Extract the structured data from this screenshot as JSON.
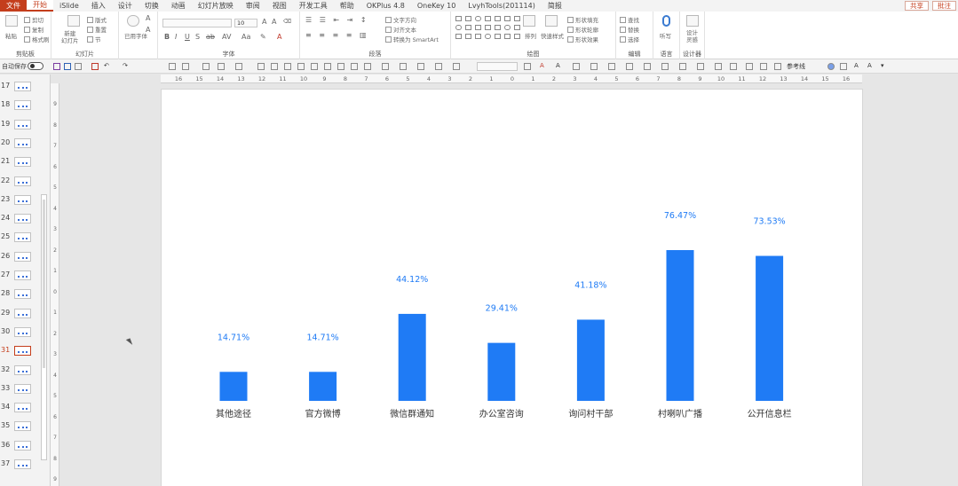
{
  "colors": {
    "accent": "#c43e1c",
    "bar": "#1f7bf5",
    "label": "#1f7bf5",
    "category": "#333333"
  },
  "menu": {
    "tabs": [
      "文件",
      "开始",
      "iSlide",
      "插入",
      "设计",
      "切换",
      "动画",
      "幻灯片放映",
      "审阅",
      "视图",
      "开发工具",
      "帮助",
      "OKPlus 4.8",
      "OneKey 10",
      "LvyhTools(201114)",
      "简报"
    ],
    "active": "开始",
    "share": "共享",
    "comment": "批注"
  },
  "ribbon": {
    "groups": {
      "clipboard": {
        "label": "剪贴板",
        "paste": "粘贴",
        "cut": "剪切",
        "copy": "复制",
        "format_painter": "格式刷"
      },
      "slides": {
        "label": "幻灯片",
        "new_slide": "新建\n幻灯片",
        "layout": "版式",
        "reset": "重置",
        "section": "节"
      },
      "fonts": {
        "label": "字体",
        "used_fonts": "已用字体",
        "font_size": "10"
      },
      "paragraph": {
        "label": "段落",
        "text_direction": "文字方向",
        "align_text": "对齐文本",
        "smartart": "转换为 SmartArt"
      },
      "drawing": {
        "label": "绘图",
        "arrange": "排列",
        "quick_styles": "快速样式",
        "shape_fill": "形状填充",
        "shape_outline": "形状轮廓",
        "shape_effects": "形状效果"
      },
      "editing": {
        "label": "编辑",
        "find": "查找",
        "replace": "替换",
        "select": "选择"
      },
      "voice": {
        "label": "语言",
        "dictate": "听写"
      },
      "designer": {
        "label": "设计器",
        "design_ideas": "设计\n灵感"
      }
    }
  },
  "qat": {
    "autosave": "自动保存",
    "autosave_state": "关",
    "reference_line": "参考线"
  },
  "thumbnails": {
    "numbers": [
      "17",
      "18",
      "19",
      "20",
      "21",
      "22",
      "23",
      "24",
      "25",
      "26",
      "27",
      "28",
      "29",
      "30",
      "31",
      "32",
      "33",
      "34",
      "35",
      "36",
      "37"
    ],
    "active": "31"
  },
  "rulers": {
    "horizontal": [
      "16",
      "15",
      "14",
      "13",
      "12",
      "11",
      "10",
      "9",
      "8",
      "7",
      "6",
      "5",
      "4",
      "3",
      "2",
      "1",
      "0",
      "1",
      "2",
      "3",
      "4",
      "5",
      "6",
      "7",
      "8",
      "9",
      "10",
      "11",
      "12",
      "13",
      "14",
      "15",
      "16"
    ],
    "vertical": [
      "9",
      "8",
      "7",
      "6",
      "5",
      "4",
      "3",
      "2",
      "1",
      "0",
      "1",
      "2",
      "3",
      "4",
      "5",
      "6",
      "7",
      "8",
      "9"
    ]
  },
  "chart_data": {
    "type": "bar",
    "categories": [
      "其他途径",
      "官方微博",
      "微信群通知",
      "办公室咨询",
      "询问村干部",
      "村喇叭广播",
      "公开信息栏"
    ],
    "values": [
      14.71,
      14.71,
      44.12,
      29.41,
      41.18,
      76.47,
      73.53
    ],
    "value_labels": [
      "14.71%",
      "14.71%",
      "44.12%",
      "29.41%",
      "41.18%",
      "76.47%",
      "73.53%"
    ],
    "title": "",
    "xlabel": "",
    "ylabel": "",
    "grid": false,
    "legend": "none"
  }
}
